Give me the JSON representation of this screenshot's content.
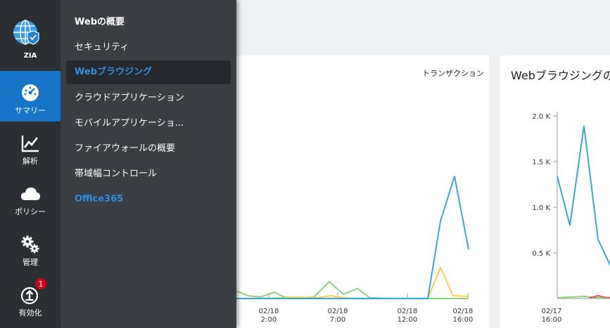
{
  "app": {
    "name": "ZIA"
  },
  "rail": {
    "items": [
      {
        "label": "サマリー",
        "icon": "dashboard-gauge-icon",
        "active": true
      },
      {
        "label": "解析",
        "icon": "line-chart-icon",
        "active": false
      },
      {
        "label": "ポリシー",
        "icon": "cloud-icon",
        "active": false
      },
      {
        "label": "管理",
        "icon": "gears-icon",
        "active": false
      },
      {
        "label": "有効化",
        "icon": "upload-icon",
        "active": false,
        "badge": "1"
      }
    ]
  },
  "flyout": {
    "items": [
      {
        "label": "Webの概要"
      },
      {
        "label": "セキュリティ"
      },
      {
        "label": "Webブラウジング",
        "selected": true
      },
      {
        "label": "クラウドアプリケーション"
      },
      {
        "label": "モバイルアプリケーショ..."
      },
      {
        "label": "ファイアウォールの概要"
      },
      {
        "label": "帯域幅コントロール"
      },
      {
        "label": "Office365"
      }
    ]
  },
  "card1": {
    "subtitle": "トランザクション",
    "x_ticks": [
      {
        "line1": "02/18",
        "line2": "2:00"
      },
      {
        "line1": "02/18",
        "line2": "7:00"
      },
      {
        "line1": "02/18",
        "line2": "12:00"
      },
      {
        "line1": "02/18",
        "line2": "16:00"
      }
    ]
  },
  "card2": {
    "title": "Webブラウジングの",
    "y_ticks": [
      "2.0 K",
      "1.5 K",
      "1.0 K",
      "0.5 K"
    ],
    "x_tick": {
      "line1": "02/17",
      "line2": "16:00"
    }
  },
  "colors": {
    "accent": "#1675c6",
    "link": "#2f8fe0",
    "series_blue": "#3aa7cf",
    "series_green": "#8fd07f",
    "series_yellow": "#f5cf4c",
    "series_red": "#e05a4f"
  }
}
